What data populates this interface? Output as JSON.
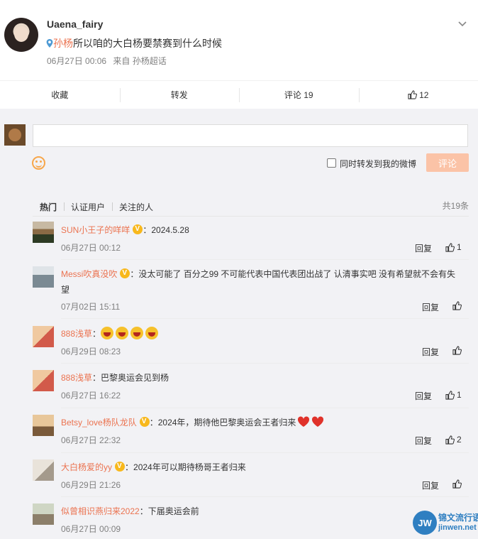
{
  "post": {
    "user": "Uaena_fairy",
    "topic": "孙杨",
    "text": "所以咱的大白杨要禁赛到什么时候",
    "time": "06月27日 00:06",
    "source": "来自 孙杨超话"
  },
  "actions": {
    "favorite": "收藏",
    "forward": "转发",
    "comment": "评论 19",
    "like_count": "12"
  },
  "compose": {
    "forward_label": "同时转发到我的微博",
    "submit": "评论"
  },
  "tabs": {
    "hot": "热门",
    "verified": "认证用户",
    "following": "关注的人",
    "total": "共19条"
  },
  "comments": [
    {
      "user": "SUN小王子的咩咩",
      "sep": "：",
      "text": "2024.5.28",
      "time": "06月27日 00:12",
      "reply": "回复",
      "likes": "1"
    },
    {
      "user": "Messi吹真没吹",
      "sep": "：",
      "text": "没太可能了 百分之99 不可能代表中国代表团出战了 认清事实吧 没有希望就不会有失望",
      "time": "07月02日 15:11",
      "reply": "回复",
      "likes": ""
    },
    {
      "user": "888浅草",
      "sep": "：",
      "text": "",
      "time": "06月29日 08:23",
      "reply": "回复",
      "likes": ""
    },
    {
      "user": "888浅草",
      "sep": "：",
      "text": "巴黎奥运会见到杨",
      "time": "06月27日 16:22",
      "reply": "回复",
      "likes": "1"
    },
    {
      "user": "Betsy_love杨队龙队",
      "sep": "：",
      "text": "2024年，期待他巴黎奥运会王者归来",
      "time": "06月27日 22:32",
      "reply": "回复",
      "likes": "2"
    },
    {
      "user": "大白杨爱的yy",
      "sep": "：",
      "text": "2024年可以期待杨哥王者归来",
      "time": "06月29日 21:26",
      "reply": "回复",
      "likes": ""
    },
    {
      "user": "似曾相识燕归来2022",
      "sep": "：",
      "text": "下届奥运会前",
      "time": "06月27日 00:09",
      "reply": "",
      "likes": ""
    }
  ],
  "watermark": {
    "logo": "JW",
    "name": "锦文流行语",
    "url": "jinwen.net"
  },
  "colors": {
    "accent": "#eb7350",
    "vip": "#f8b81c",
    "submit_disabled": "#fbc3a7",
    "watermark": "#2f7fc1"
  }
}
